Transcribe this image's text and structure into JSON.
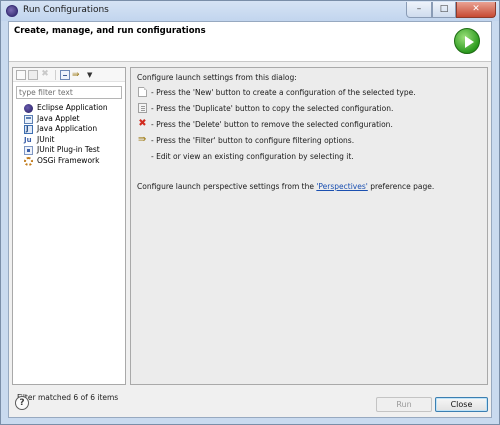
{
  "window": {
    "title": "Run Configurations",
    "controls": {
      "minimize": "–",
      "maximize": "□",
      "close": "✕"
    }
  },
  "header": {
    "title": "Create, manage, and run configurations",
    "icon": "run-icon",
    "accent": "#2c9a1f"
  },
  "left_pane": {
    "toolbar": [
      "new-config-icon",
      "duplicate-icon",
      "delete-icon",
      "collapse-all-icon",
      "filter-icon",
      "view-menu-icon"
    ],
    "filter": {
      "value": "",
      "placeholder": "type filter text"
    },
    "items": [
      {
        "label": "Eclipse Application",
        "icon": "eclipse-icon"
      },
      {
        "label": "Java Applet",
        "icon": "java-applet-icon"
      },
      {
        "label": "Java Application",
        "icon": "java-app-icon"
      },
      {
        "label": "JUnit",
        "icon": "junit-icon"
      },
      {
        "label": "JUnit Plug-in Test",
        "icon": "junit-plugin-icon"
      },
      {
        "label": "OSGi Framework",
        "icon": "osgi-icon"
      }
    ],
    "status": "Filter matched 6 of 6 items"
  },
  "right_pane": {
    "intro": "Configure launch settings from this dialog:",
    "instructions": [
      {
        "icon": "new-config-icon",
        "text": "- Press the 'New' button to create a configuration of the selected type."
      },
      {
        "icon": "duplicate-icon",
        "text": "- Press the 'Duplicate' button to copy the selected configuration."
      },
      {
        "icon": "delete-icon",
        "text": "- Press the 'Delete' button to remove the selected configuration."
      },
      {
        "icon": "filter-icon",
        "text": "- Press the 'Filter' button to configure filtering options."
      },
      {
        "icon": "",
        "text": "- Edit or view an existing configuration by selecting it."
      }
    ],
    "perspective": {
      "before": "Configure launch perspective settings from the ",
      "link": "'Perspectives'",
      "after": " preference page."
    }
  },
  "footer": {
    "help": "?",
    "run": "Run",
    "close": "Close"
  }
}
